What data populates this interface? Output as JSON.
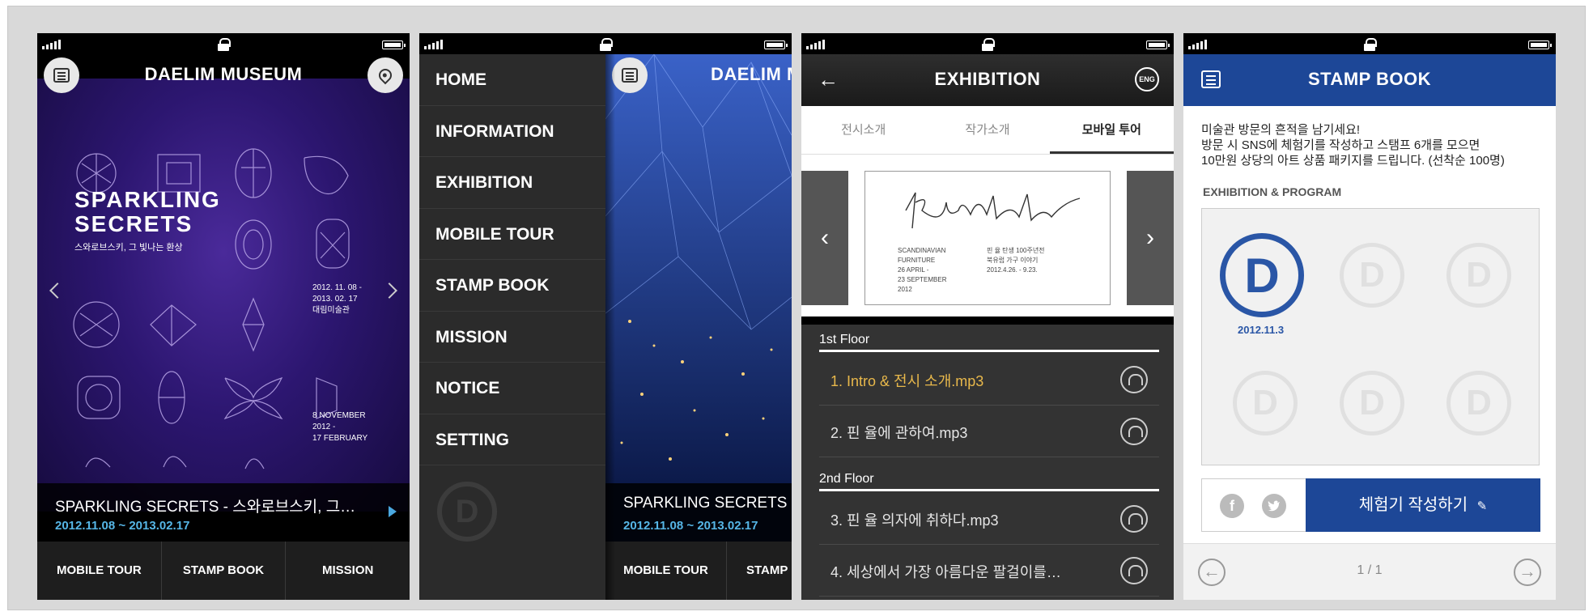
{
  "colors": {
    "poster_purple": "#2c1670",
    "date_blue": "#56b6e6",
    "brand_blue": "#1d4797",
    "track_highlight": "#e8b84b"
  },
  "home": {
    "title": "DAELIM MUSEUM",
    "menu_icon": "list-icon",
    "location_icon": "location-pin-icon",
    "poster": {
      "headline_1": "SPARKLING",
      "headline_2": "SECRETS",
      "subtitle": "스와로브스키, 그 빛나는 환상",
      "dates_ko": "2012. 11. 08 -\n2013. 02. 17\n대림미술관",
      "dates_en": "8 NOVEMBER\n2012 -\n17 FEBRUARY"
    },
    "info": {
      "title": "SPARKLING SECRETS - 스와로브스키, 그…",
      "dates": "2012.11.08 ~ 2013.02.17"
    },
    "tabs": [
      "MOBILE TOUR",
      "STAMP BOOK",
      "MISSION"
    ]
  },
  "menu": {
    "items": [
      "HOME",
      "INFORMATION",
      "EXHIBITION",
      "MOBILE TOUR",
      "STAMP BOOK",
      "MISSION",
      "NOTICE",
      "SETTING"
    ],
    "bg_title": "DAELIM M",
    "info_title": "SPARKLING SECRETS -",
    "info_dates": "2012.11.08 ~ 2013.02.17",
    "tabs": [
      "MOBILE TOUR",
      "STAMP"
    ]
  },
  "exhibition": {
    "title": "EXHIBITION",
    "lang_badge": "ENG",
    "tabs": [
      "전시소개",
      "작가소개",
      "모바일 투어"
    ],
    "active_tab": "모바일 투어",
    "card_left": "SCANDINAVIAN\nFURNITURE\n26 APRIL -\n23 SEPTEMBER\n2012",
    "card_right": "핀 율 탄생 100주년전\n북유럽 가구 이야기\n2012.4.26. - 9.23.",
    "floors": [
      {
        "label": "1st Floor",
        "tracks": [
          "1. Intro & 전시 소개.mp3",
          "2. 핀 율에 관하여.mp3"
        ]
      },
      {
        "label": "2nd Floor",
        "tracks": [
          "3. 핀 율 의자에 취하다.mp3",
          "4. 세상에서 가장 아름다운 팔걸이를…"
        ]
      }
    ]
  },
  "stampbook": {
    "title": "STAMP BOOK",
    "intro_1": "미술관 방문의 흔적을 남기세요!",
    "intro_2": "방문 시 SNS에 체험기를 작성하고 스탬프 6개를 모으면",
    "intro_3": "10만원 상당의 아트 상품 패키지를 드립니다. (선착순 100명)",
    "section": "EXHIBITION & PROGRAM",
    "stamp_letter": "D",
    "stamp_date": "2012.11.3",
    "facebook": "f",
    "write_button": "체험기 작성하기",
    "page": "1 / 1"
  }
}
